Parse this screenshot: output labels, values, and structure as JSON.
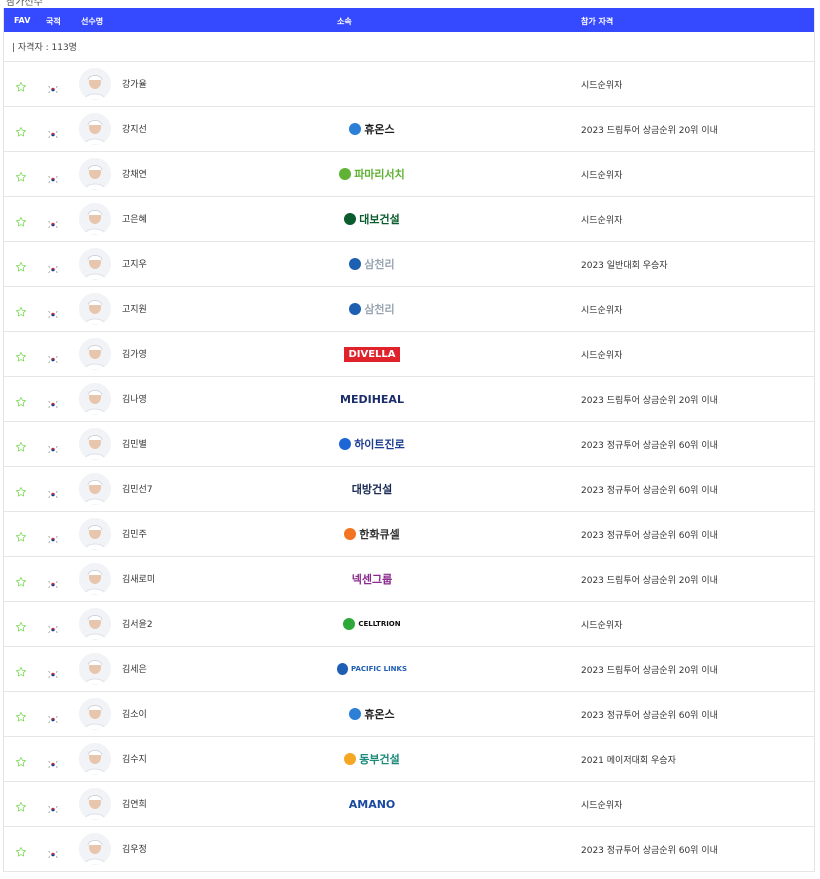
{
  "page": {
    "section_title": "참가선수"
  },
  "table": {
    "headers": {
      "fav": "FAV",
      "nation": "국적",
      "player": "선수명",
      "club": "소속",
      "qualification": "참가 자격"
    },
    "count_text": "| 자격자 : 113명",
    "rows": [
      {
        "name": "강가율",
        "club": "",
        "qualification": "시드순위자",
        "photo": "player-photo"
      },
      {
        "name": "강지선",
        "club": "휴온스",
        "qualification": "2023 드림투어 상금순위 20위 이내"
      },
      {
        "name": "강채연",
        "club": "파마리서치",
        "qualification": "시드순위자"
      },
      {
        "name": "고은혜",
        "club": "대보건설",
        "qualification": "시드순위자"
      },
      {
        "name": "고지우",
        "club": "삼천리",
        "qualification": "2023 일반대회 우승자"
      },
      {
        "name": "고지원",
        "club": "삼천리",
        "qualification": "시드순위자"
      },
      {
        "name": "김가영",
        "club": "DIVELLA",
        "qualification": "시드순위자"
      },
      {
        "name": "김나영",
        "club": "MEDIHEAL",
        "qualification": "2023 드림투어 상금순위 20위 이내"
      },
      {
        "name": "김민별",
        "club": "하이트진로",
        "qualification": "2023 정규투어 상금순위 60위 이내"
      },
      {
        "name": "김민선7",
        "club": "대방건설",
        "qualification": "2023 정규투어 상금순위 60위 이내"
      },
      {
        "name": "김민주",
        "club": "한화큐셀",
        "qualification": "2023 정규투어 상금순위 60위 이내"
      },
      {
        "name": "김새로미",
        "club": "넥센그룹",
        "qualification": "2023 드림투어 상금순위 20위 이내"
      },
      {
        "name": "김서윤2",
        "club": "CELLTRION",
        "qualification": "시드순위자"
      },
      {
        "name": "김세은",
        "club": "PACIFIC LINKS",
        "qualification": "2023 드림투어 상금순위 20위 이내"
      },
      {
        "name": "김소이",
        "club": "휴온스",
        "qualification": "2023 정규투어 상금순위 60위 이내"
      },
      {
        "name": "김수지",
        "club": "동부건설",
        "qualification": "2021 메이저대회 우승자"
      },
      {
        "name": "김연희",
        "club": "AMANO",
        "qualification": "시드순위자"
      },
      {
        "name": "김우정",
        "club": "",
        "qualification": "2023 정규투어 상금순위 60위 이내"
      }
    ]
  },
  "colors": {
    "header_bg": "#3549ff",
    "star": "#7ed957",
    "border": "#e6e6e6"
  },
  "icons": {
    "fav": "star-outline-icon",
    "nation": "korea-flag-icon"
  }
}
